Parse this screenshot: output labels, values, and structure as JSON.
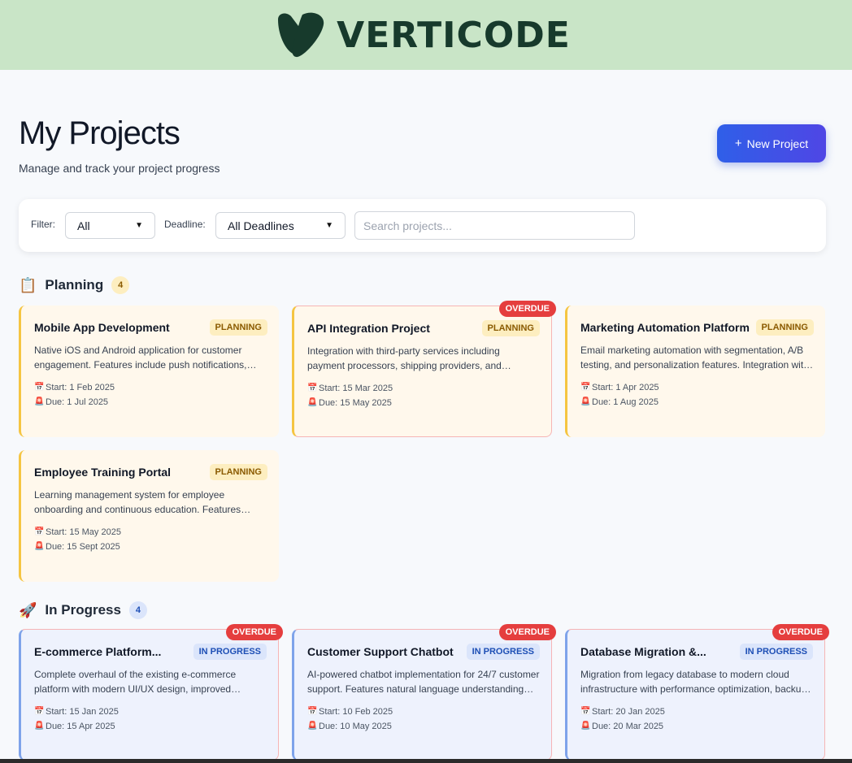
{
  "brand": {
    "name": "VERTICODE",
    "color": "#173a2c",
    "banner_color": "#c9e5c7"
  },
  "header": {
    "title": "My Projects",
    "subtitle": "Manage and track your project progress",
    "new_button_icon": "plus-icon",
    "new_button_label": "New Project"
  },
  "filters": {
    "filter_label": "Filter:",
    "filter_value": "All",
    "deadline_label": "Deadline:",
    "deadline_value": "All Deadlines",
    "search_placeholder": "Search projects..."
  },
  "icons": {
    "start": "calendar-icon",
    "due": "alarm-icon"
  },
  "sections": [
    {
      "icon": "clipboard-icon",
      "title": "Planning",
      "count": "4",
      "projects": [
        {
          "title": "Mobile App Development",
          "status": "PLANNING",
          "overdue": "",
          "description": "Native iOS and Android application for customer engagement. Features include push notifications, offline mode and secure payments.",
          "start": "Start: 1 Feb 2025",
          "due": "Due: 1 Jul 2025"
        },
        {
          "title": "API Integration Project",
          "status": "PLANNING",
          "overdue": "OVERDUE",
          "description": "Integration with third-party services including payment processors, shipping providers, and analytics platforms.",
          "start": "Start: 15 Mar 2025",
          "due": "Due: 15 May 2025"
        },
        {
          "title": "Marketing Automation Platform",
          "status": "PLANNING",
          "overdue": "",
          "description": "Email marketing automation with segmentation, A/B testing, and personalization features. Integration with CRM.",
          "start": "Start: 1 Apr 2025",
          "due": "Due: 1 Aug 2025"
        },
        {
          "title": "Employee Training Portal",
          "status": "PLANNING",
          "overdue": "",
          "description": "Learning management system for employee onboarding and continuous education. Features quizzes and certificates.",
          "start": "Start: 15 May 2025",
          "due": "Due: 15 Sept 2025"
        }
      ]
    },
    {
      "icon": "rocket-icon",
      "title": "In Progress",
      "count": "4",
      "projects": [
        {
          "title": "E-commerce Platform...",
          "status": "IN PROGRESS",
          "overdue": "OVERDUE",
          "description": "Complete overhaul of the existing e-commerce platform with modern UI/UX design, improved checkout flow and performance.",
          "start": "Start: 15 Jan 2025",
          "due": "Due: 15 Apr 2025"
        },
        {
          "title": "Customer Support Chatbot",
          "status": "IN PROGRESS",
          "overdue": "OVERDUE",
          "description": "AI-powered chatbot implementation for 24/7 customer support. Features natural language understanding and ticket escalation.",
          "start": "Start: 10 Feb 2025",
          "due": "Due: 10 May 2025"
        },
        {
          "title": "Database Migration &...",
          "status": "IN PROGRESS",
          "overdue": "OVERDUE",
          "description": "Migration from legacy database to modern cloud infrastructure with performance optimization, backup and recovery.",
          "start": "Start: 20 Jan 2025",
          "due": "Due: 20 Mar 2025"
        }
      ]
    }
  ]
}
